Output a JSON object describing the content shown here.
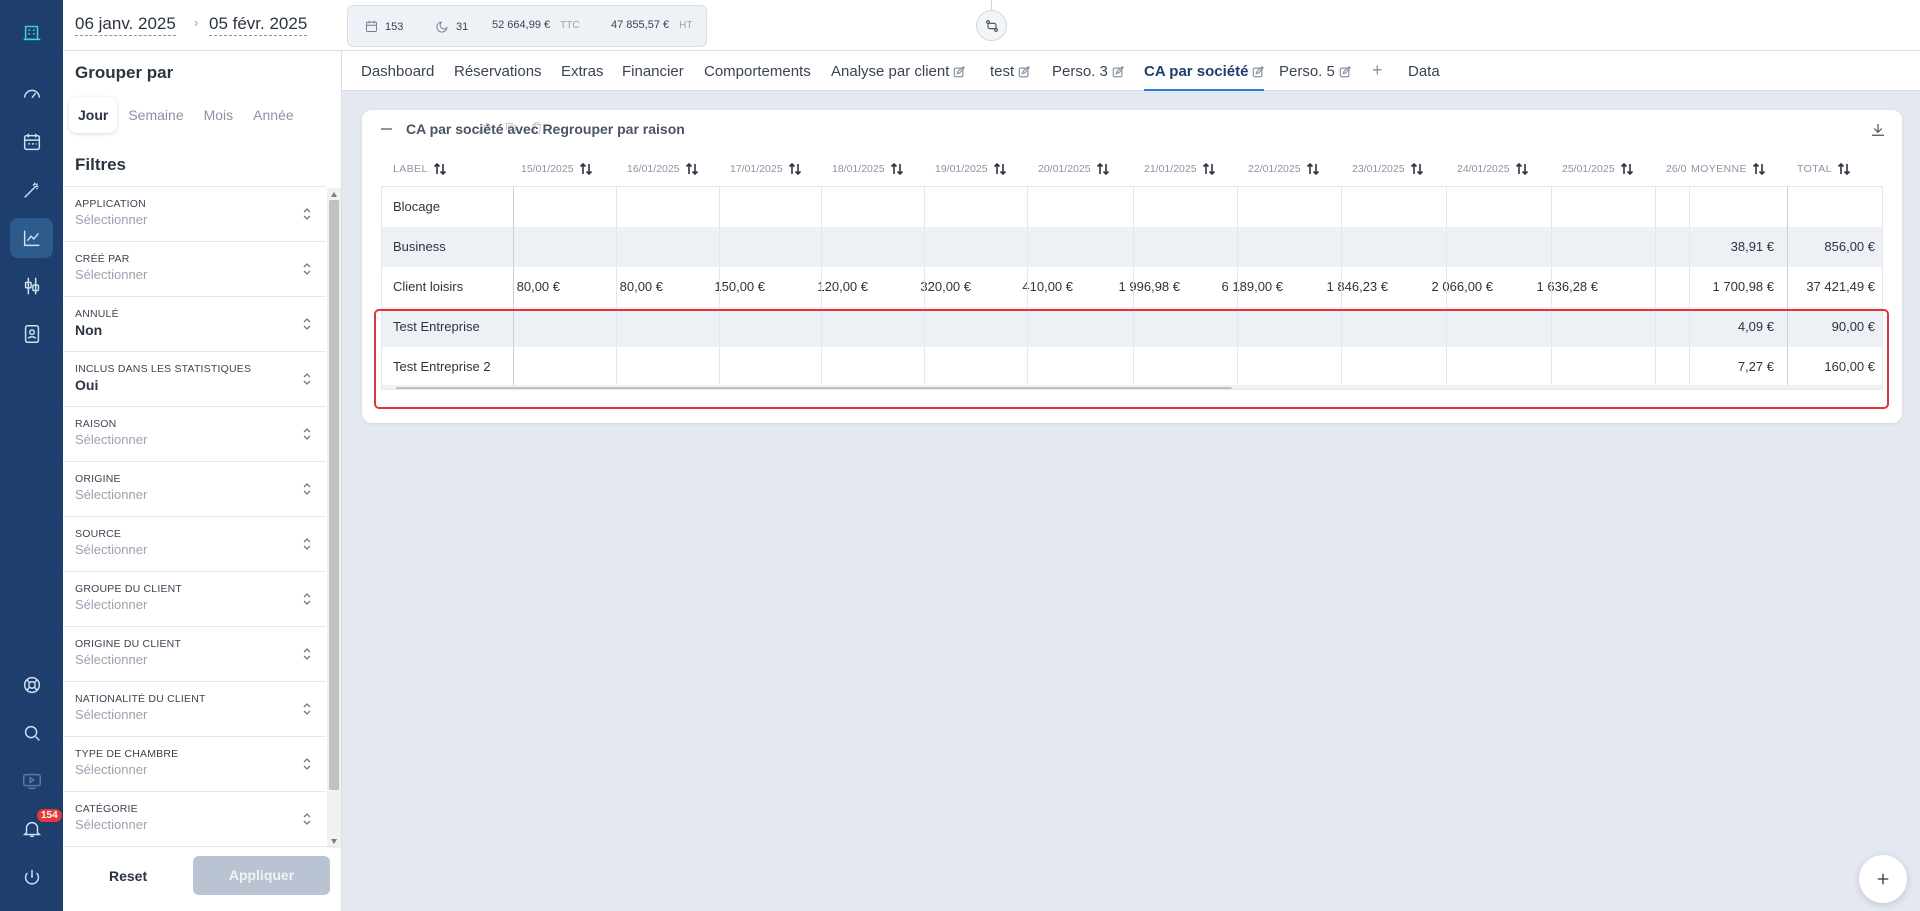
{
  "topbar": {
    "date_start": "06 janv. 2025",
    "date_sep": "›",
    "date_end": "05 févr. 2025",
    "stats": {
      "bookings": "153",
      "nights": "31",
      "ttc_value": "52 664,99 €",
      "ttc_unit": "TTC",
      "ht_value": "47 855,57 €",
      "ht_unit": "HT"
    }
  },
  "sidebar_rail": {
    "notification_count": "154"
  },
  "panel": {
    "group_title": "Grouper par",
    "group_options": [
      "Jour",
      "Semaine",
      "Mois",
      "Année"
    ],
    "group_selected": "Jour",
    "filters_title": "Filtres",
    "filters": [
      {
        "label": "APPLICATION",
        "value": "Sélectionner",
        "set": false
      },
      {
        "label": "CRÉÉ PAR",
        "value": "Sélectionner",
        "set": false
      },
      {
        "label": "ANNULÉ",
        "value": "Non",
        "set": true
      },
      {
        "label": "INCLUS DANS LES STATISTIQUES",
        "value": "Oui",
        "set": true
      },
      {
        "label": "RAISON",
        "value": "Sélectionner",
        "set": false
      },
      {
        "label": "ORIGINE",
        "value": "Sélectionner",
        "set": false
      },
      {
        "label": "SOURCE",
        "value": "Sélectionner",
        "set": false
      },
      {
        "label": "GROUPE DU CLIENT",
        "value": "Sélectionner",
        "set": false
      },
      {
        "label": "ORIGINE DU CLIENT",
        "value": "Sélectionner",
        "set": false
      },
      {
        "label": "NATIONALITÉ DU CLIENT",
        "value": "Sélectionner",
        "set": false
      },
      {
        "label": "TYPE DE CHAMBRE",
        "value": "Sélectionner",
        "set": false
      },
      {
        "label": "CATÉGORIE",
        "value": "Sélectionner",
        "set": false
      }
    ],
    "reset_label": "Reset",
    "apply_label": "Appliquer"
  },
  "tabs": [
    {
      "label": "Dashboard",
      "editable": false
    },
    {
      "label": "Réservations",
      "editable": false
    },
    {
      "label": "Extras",
      "editable": false
    },
    {
      "label": "Financier",
      "editable": false
    },
    {
      "label": "Comportements",
      "editable": false
    },
    {
      "label": "Analyse par client",
      "editable": true
    },
    {
      "label": "test",
      "editable": true
    },
    {
      "label": "Perso. 3",
      "editable": true
    },
    {
      "label": "CA par société",
      "editable": true,
      "active": true
    },
    {
      "label": "Perso. 5",
      "editable": true
    },
    {
      "label": "+",
      "editable": false
    },
    {
      "label": "Data",
      "editable": false
    }
  ],
  "report": {
    "title": "CA par société avec Regrouper par raison",
    "columns": {
      "label": "LABEL",
      "dates": [
        "15/01/2025",
        "16/01/2025",
        "17/01/2025",
        "18/01/2025",
        "19/01/2025",
        "20/01/2025",
        "21/01/2025",
        "22/01/2025",
        "23/01/2025",
        "24/01/2025",
        "25/01/2025",
        "26/0"
      ],
      "average": "MOYENNE",
      "total": "TOTAL"
    },
    "rows": [
      {
        "name": "Blocage",
        "values": [
          "",
          "",
          "",
          "",
          "",
          "",
          "",
          "",
          "",
          "",
          "",
          ""
        ],
        "average": "",
        "total": ""
      },
      {
        "name": "Business",
        "values": [
          "",
          "",
          "",
          "",
          "",
          "",
          "",
          "",
          "",
          "",
          "",
          ""
        ],
        "average": "38,91 €",
        "total": "856,00 €"
      },
      {
        "name": "Client loisirs",
        "values": [
          "80,00 €",
          "80,00 €",
          "150,00 €",
          "120,00 €",
          "320,00 €",
          "410,00 €",
          "1 996,98 €",
          "6 189,00 €",
          "1 846,23 €",
          "2 066,00 €",
          "1 636,28 €",
          ""
        ],
        "average": "1 700,98 €",
        "total": "37 421,49 €"
      },
      {
        "name": "Test Entreprise",
        "values": [
          "",
          "",
          "",
          "",
          "",
          "",
          "",
          "",
          "",
          "",
          "",
          ""
        ],
        "average": "4,09 €",
        "total": "90,00 €"
      },
      {
        "name": "Test Entreprise 2",
        "values": [
          "",
          "",
          "",
          "",
          "",
          "",
          "",
          "",
          "",
          "",
          "",
          ""
        ],
        "average": "7,27 €",
        "total": "160,00 €"
      }
    ]
  },
  "colors": {
    "rail": "#1e3f6e",
    "accent": "#2f7ad6",
    "highlight_border": "#e0343a"
  }
}
